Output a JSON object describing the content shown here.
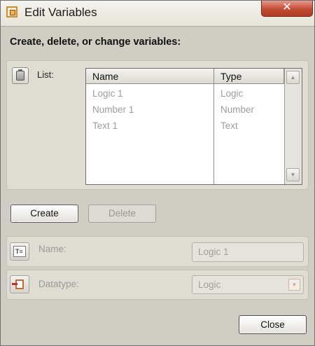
{
  "window": {
    "title": "Edit Variables",
    "close_glyph": "✕",
    "icon": "variables-app-icon",
    "accent_color": "#d88a2a"
  },
  "heading": "Create, delete, or change variables:",
  "list": {
    "label": "List:",
    "icon": "clipboard-icon",
    "columns": [
      "Name",
      "Type"
    ],
    "rows": [
      {
        "name": "Logic 1",
        "type": "Logic"
      },
      {
        "name": "Number 1",
        "type": "Number"
      },
      {
        "name": "Text 1",
        "type": "Text"
      }
    ],
    "scroll_up_glyph": "▲",
    "scroll_down_glyph": "▼"
  },
  "buttons": {
    "create": "Create",
    "delete": "Delete",
    "close": "Close"
  },
  "name_field": {
    "label": "Name:",
    "icon": "text-field-icon",
    "icon_glyph": "T≡",
    "value": "Logic 1"
  },
  "datatype_field": {
    "label": "Datatype:",
    "icon": "datatype-icon",
    "value": "Logic",
    "dropdown_glyph": "▼"
  }
}
